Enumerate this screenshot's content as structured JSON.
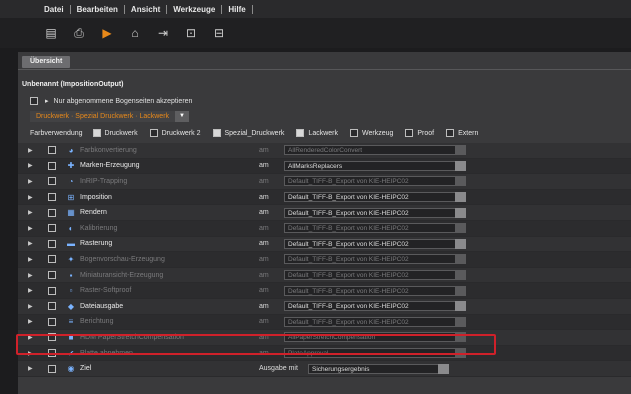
{
  "menu": [
    "Datei",
    "Bearbeiten",
    "Ansicht",
    "Werkzeuge",
    "Hilfe"
  ],
  "toolbar_icons": [
    "new-document-icon",
    "printer-icon",
    "folder-open-icon",
    "save-icon",
    "export-icon",
    "import-icon",
    "settings-icon"
  ],
  "tab_label": "Übersicht",
  "project_title": "Unbenannt (ImpositionOutput)",
  "accept_sheets_label": "Nur abgenommene Bogenseiten akzeptieren",
  "workflow_label": "Druckwerk · Spezial Druckwerk · Lackwerk",
  "filter": {
    "label": "Farbverwendung",
    "items": [
      {
        "label": "Druckwerk",
        "checked": true
      },
      {
        "label": "Druckwerk 2",
        "checked": false
      },
      {
        "label": "Spezial_Druckwerk",
        "checked": true
      },
      {
        "label": "Lackwerk",
        "checked": true
      },
      {
        "label": "Werkzeug",
        "checked": false
      },
      {
        "label": "Proof",
        "checked": false
      },
      {
        "label": "Extern",
        "checked": false
      }
    ]
  },
  "rows": [
    {
      "name": "Farbkonvertierung",
      "rel": "am",
      "value": "AllRenderedColorConvert",
      "icon": "color-convert-icon",
      "dim": true
    },
    {
      "name": "Marken-Erzeugung",
      "rel": "am",
      "value": "AllMarksReplacers",
      "icon": "marks-icon",
      "dim": false
    },
    {
      "name": "InRIP-Trapping",
      "rel": "am",
      "value": "Default_TIFF-B_Export von KIE-HEIPC02",
      "icon": "trapping-icon",
      "dim": true
    },
    {
      "name": "Imposition",
      "rel": "am",
      "value": "Default_TIFF-B_Export von KIE-HEIPC02",
      "icon": "imposition-icon",
      "dim": false
    },
    {
      "name": "Rendern",
      "rel": "am",
      "value": "Default_TIFF-B_Export von KIE-HEIPC02",
      "icon": "render-icon",
      "dim": false
    },
    {
      "name": "Kalibrierung",
      "rel": "am",
      "value": "Default_TIFF-B_Export von KIE-HEIPC02",
      "icon": "calibration-icon",
      "dim": true
    },
    {
      "name": "Rasterung",
      "rel": "am",
      "value": "Default_TIFF-B_Export von KIE-HEIPC02",
      "icon": "screening-icon",
      "dim": false
    },
    {
      "name": "Bogenvorschau-Erzeugung",
      "rel": "am",
      "value": "Default_TIFF-B_Export von KIE-HEIPC02",
      "icon": "sheet-preview-icon",
      "dim": true
    },
    {
      "name": "Miniaturansicht-Erzeugung",
      "rel": "am",
      "value": "Default_TIFF-B_Export von KIE-HEIPC02",
      "icon": "thumbnail-icon",
      "dim": true
    },
    {
      "name": "Raster-Softproof",
      "rel": "am",
      "value": "Default_TIFF-B_Export von KIE-HEIPC02",
      "icon": "softproof-icon",
      "dim": true
    },
    {
      "name": "Dateiausgabe",
      "rel": "am",
      "value": "Default_TIFF-B_Export von KIE-HEIPC02",
      "icon": "file-output-icon",
      "dim": false
    },
    {
      "name": "Berichtung",
      "rel": "am",
      "value": "Default_TIFF-B_Export von KIE-HEIPC02",
      "icon": "report-icon",
      "dim": true
    },
    {
      "name": "HDM PaperStretchCompensation",
      "rel": "am",
      "value": "AllPaperStretchCompensation",
      "icon": "paper-stretch-icon",
      "dim": true
    },
    {
      "name": "Platte abnehmen",
      "rel": "am",
      "value": "PlateApproval",
      "icon": "plate-approval-icon",
      "dim": true
    },
    {
      "name": "Ziel",
      "rel": "Ausgabe mit",
      "value": "Sicherungsergebnis",
      "icon": "target-icon",
      "dim": false
    }
  ]
}
